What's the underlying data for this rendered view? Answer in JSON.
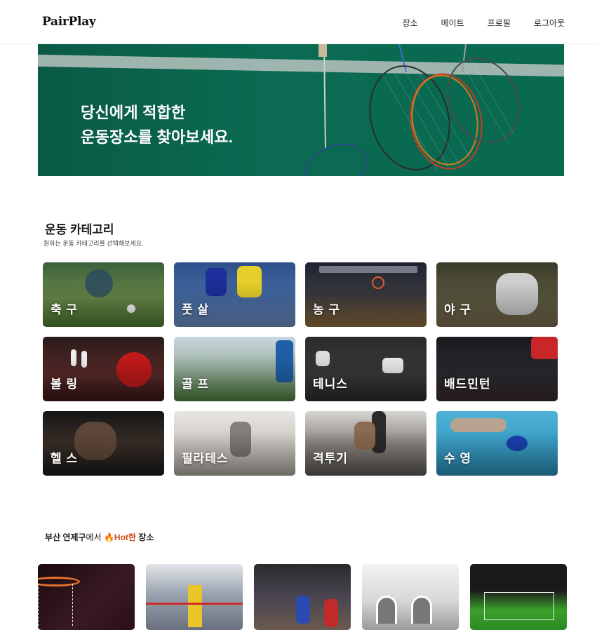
{
  "header": {
    "logo": "PairPlay",
    "nav": [
      "장소",
      "메이트",
      "프로필",
      "로그아웃"
    ]
  },
  "hero": {
    "line1": "당신에게 적합한",
    "line2": "운동장소를 찾아보세요."
  },
  "category": {
    "title": "운동 카테고리",
    "subtitle": "원하는 운동 카테고리를 선택해보세요.",
    "items": [
      "축 구",
      "풋 살",
      "농 구",
      "야 구",
      "볼 링",
      "골 프",
      "테니스",
      "배드민턴",
      "헬 스",
      "필라테스",
      "격투기",
      "수 영"
    ]
  },
  "hot": {
    "prefix": "부산 연제구",
    "middle": "에서 ",
    "fire": "🔥",
    "hot_word": "Hot한",
    "suffix": " 장소"
  },
  "colors": {
    "hero_green": "#0b6b52",
    "hot_accent": "#d9471c"
  }
}
